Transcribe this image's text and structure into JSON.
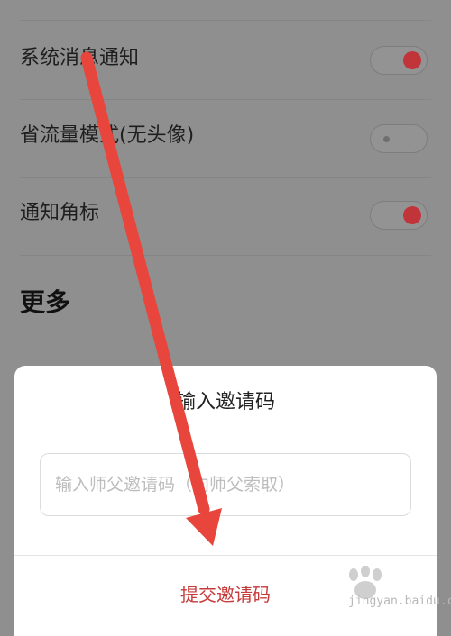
{
  "settings": {
    "rows": [
      {
        "label": "系统消息通知",
        "toggle": "on"
      },
      {
        "label": "省流量模式(无头像)",
        "toggle": "off"
      },
      {
        "label": "通知角标",
        "toggle": "on"
      }
    ],
    "section_title": "更多"
  },
  "dialog": {
    "title": "输入邀请码",
    "input_value": "",
    "input_placeholder": "输入师父邀请码（向师父索取）",
    "submit_label": "提交邀请码"
  },
  "colors": {
    "overlay": "#8f8f8f",
    "toggle_on": "#c0343a",
    "submit_text": "#c73a3a",
    "annotation_arrow": "#e8453c"
  },
  "watermark": {
    "brand": "Baidu经验",
    "url": "jingyan.baidu.com"
  }
}
